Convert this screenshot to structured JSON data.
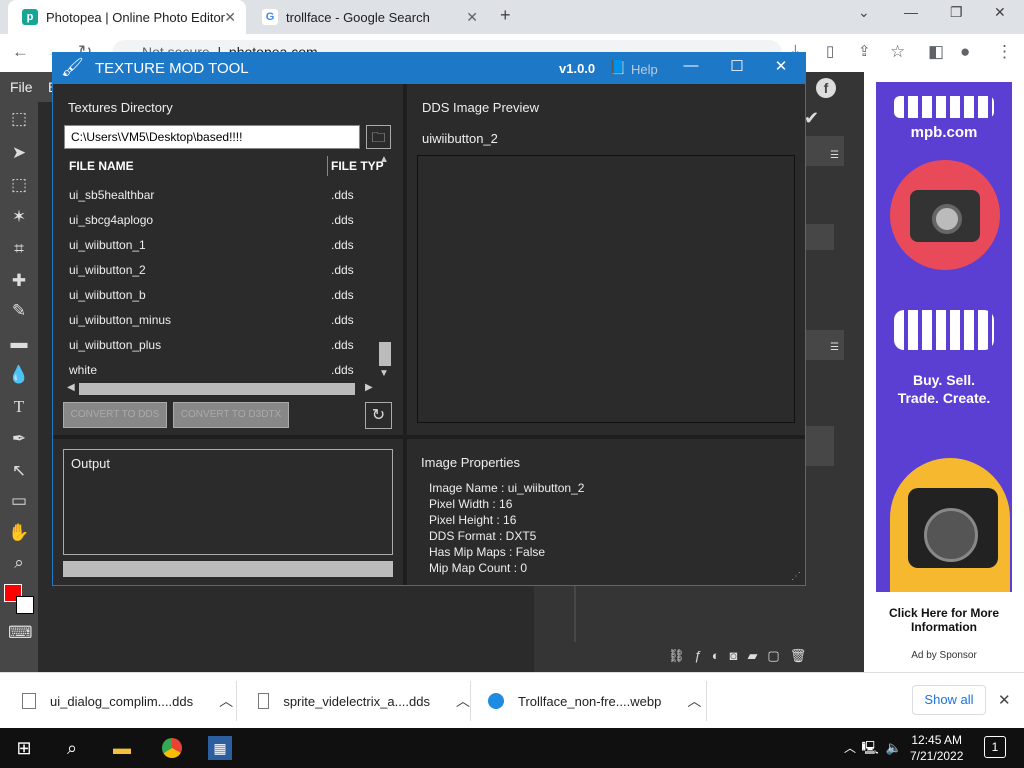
{
  "browser": {
    "tabs": [
      {
        "title": "Photopea | Online Photo Editor"
      },
      {
        "title": "trollface - Google Search"
      }
    ],
    "security": "Not secure",
    "url": "photopea.com"
  },
  "photopea": {
    "menu_file": "File",
    "menu_e": "E"
  },
  "ad": {
    "brand": "mpb.com",
    "tag1": "Buy. Sell.",
    "tag2": "Trade. Create.",
    "cta": "Click Here for More Information",
    "sponsor": "Ad by Sponsor"
  },
  "tool": {
    "title": "TEXTURE MOD TOOL",
    "version": "v1.0.0",
    "help": "Help",
    "textures_directory_label": "Textures Directory",
    "path": "C:\\Users\\VM5\\Desktop\\based!!!!",
    "col_file_name": "FILE NAME",
    "col_file_type": "FILE TYP",
    "files": [
      {
        "name": "ui_sb5healthbar",
        "ext": ".dds"
      },
      {
        "name": "ui_sbcg4aplogo",
        "ext": ".dds"
      },
      {
        "name": "ui_wiibutton_1",
        "ext": ".dds"
      },
      {
        "name": "ui_wiibutton_2",
        "ext": ".dds"
      },
      {
        "name": "ui_wiibutton_b",
        "ext": ".dds"
      },
      {
        "name": "ui_wiibutton_minus",
        "ext": ".dds"
      },
      {
        "name": "ui_wiibutton_plus",
        "ext": ".dds"
      },
      {
        "name": "white",
        "ext": ".dds"
      }
    ],
    "convert_dds": "CONVERT TO DDS",
    "convert_d3dtx": "CONVERT TO D3DTX",
    "output_label": "Output",
    "preview_label": "DDS Image Preview",
    "preview_name": "uiwiibutton_2",
    "props_label": "Image Properties",
    "props": {
      "image_name": "Image Name : ui_wiibutton_2",
      "pixel_width": "Pixel Width : 16",
      "pixel_height": "Pixel Height : 16",
      "dds_format": "DDS Format : DXT5",
      "mip_maps": "Has Mip Maps : False",
      "mip_count": "Mip Map Count : 0"
    }
  },
  "downloads": [
    {
      "name": "ui_dialog_complim....dds"
    },
    {
      "name": "sprite_videlectrix_a....dds"
    },
    {
      "name": "Trollface_non-fre....webp"
    }
  ],
  "show_all": "Show all",
  "taskbar": {
    "time": "12:45 AM",
    "date": "7/21/2022",
    "notif_count": "1"
  },
  "colors": {
    "tool_titlebar": "#1e78c8",
    "fg_color": "#ff0000",
    "ad_purple": "#5b3fd3"
  }
}
